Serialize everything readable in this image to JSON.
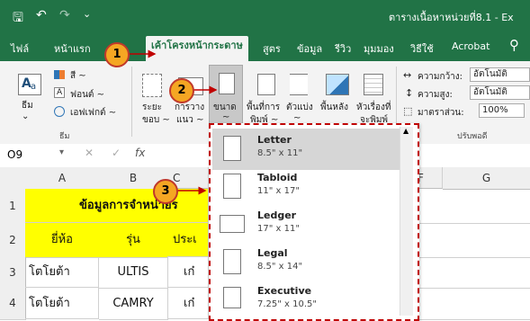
{
  "window": {
    "title": "ตารางเนื้อหาหน่วยที่8.1 - Ex"
  },
  "quick_access": {
    "save": "🖫",
    "undo": "↶",
    "redo": "↷",
    "customize": "⌄"
  },
  "tabs": [
    "ไฟล์",
    "หน้าแรก",
    "เค้าโครงหน้ากระดาษ",
    "สูตร",
    "ข้อมูล",
    "รีวิว",
    "มุมมอง",
    "วิธีใช้",
    "Acrobat"
  ],
  "tell_me_icon": "lightbulb-icon",
  "ribbon": {
    "themes": {
      "label": "ธีม",
      "colors": "สี ~",
      "fonts": "ฟอนต์ ~",
      "effects": "เอฟเฟกต์ ~",
      "group": "ธีม"
    },
    "margins": {
      "label1": "ระยะ",
      "label2": "ขอบ ~"
    },
    "orientation": {
      "label1": "การวาง",
      "label2": "แนว ~"
    },
    "size": {
      "label1": "ขนาด",
      "label2": "~"
    },
    "print_area": {
      "label1": "พื้นที่การ",
      "label2": "พิมพ์ ~"
    },
    "breaks": {
      "label1": "ตัวแบ่ง",
      "label2": "~"
    },
    "background": {
      "label1": "พื้นหลัง"
    },
    "print_titles": {
      "label1": "หัวเรื่องที่",
      "label2": "จะพิมพ์"
    },
    "scale": {
      "width_label": "ความกว้าง:",
      "width_value": "อัตโนมัติ",
      "height_label": "ความสูง:",
      "height_value": "อัตโนมัติ",
      "scale_label": "มาตราส่วน:",
      "scale_value": "100%",
      "group": "ปรับพอดี"
    }
  },
  "formula_bar": {
    "name_box": "O9",
    "cancel": "✕",
    "enter": "✓",
    "fx": "fx"
  },
  "sheet": {
    "columns": [
      "A",
      "B",
      "C",
      "F",
      "G"
    ],
    "rows": [
      {
        "num": "1",
        "cells": [
          "ข้อมูลการจำหน่ายร"
        ]
      },
      {
        "num": "2",
        "cells": [
          "ยี่ห้อ",
          "รุ่น",
          "ประเ"
        ]
      },
      {
        "num": "3",
        "cells": [
          "โตโยต้า",
          "ULTIS",
          "เก๋"
        ]
      },
      {
        "num": "4",
        "cells": [
          "โตโยต้า",
          "CAMRY",
          "เก๋"
        ]
      }
    ]
  },
  "size_dropdown": [
    {
      "name": "Letter",
      "dims": "8.5\" x 11\""
    },
    {
      "name": "Tabloid",
      "dims": "11\" x 17\""
    },
    {
      "name": "Ledger",
      "dims": "17\" x 11\""
    },
    {
      "name": "Legal",
      "dims": "8.5\" x 14\""
    },
    {
      "name": "Executive",
      "dims": "7.25\" x 10.5\""
    }
  ],
  "callouts": [
    "1",
    "2",
    "3"
  ],
  "colors": {
    "excel_green": "#217346",
    "header_yellow": "#ffff00",
    "callout_fill": "#f5a623",
    "callout_border": "#c0392b",
    "dashed_border": "#c00000"
  }
}
